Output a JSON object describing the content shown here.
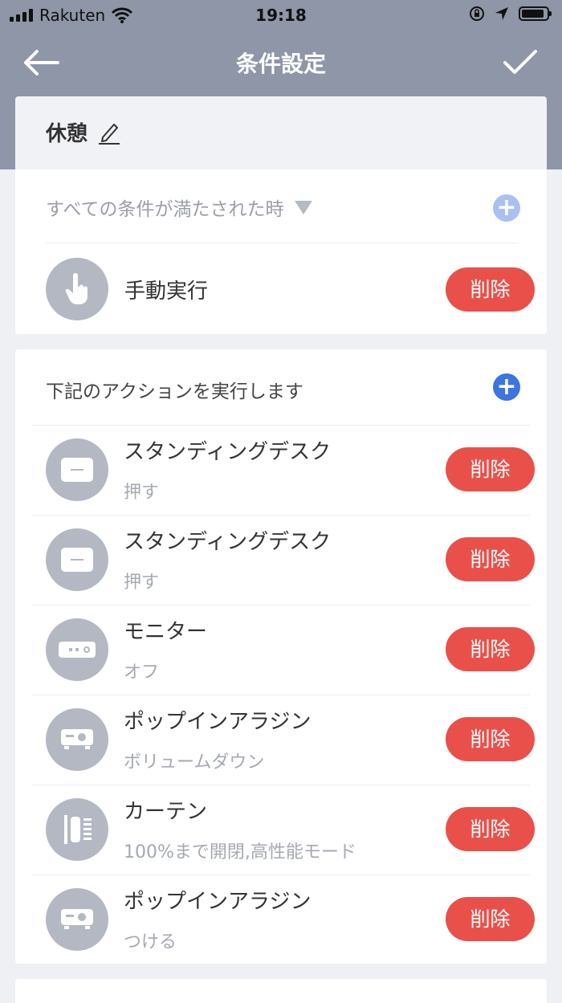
{
  "status_bar": {
    "carrier": "Rakuten",
    "time": "19:18"
  },
  "nav": {
    "title": "条件設定"
  },
  "scene": {
    "name": "休憩"
  },
  "conditions": {
    "header": "すべての条件が満たされた時",
    "items": [
      {
        "title": "手動実行",
        "icon": "hand-tap-icon",
        "delete_label": "削除"
      }
    ]
  },
  "actions": {
    "header": "下記のアクションを実行します",
    "items": [
      {
        "title": "スタンディングデスク",
        "sub": "押す",
        "icon": "bot-icon",
        "delete_label": "削除"
      },
      {
        "title": "スタンディングデスク",
        "sub": "押す",
        "icon": "bot-icon",
        "delete_label": "削除"
      },
      {
        "title": "モニター",
        "sub": "オフ",
        "icon": "remote-icon",
        "delete_label": "削除"
      },
      {
        "title": "ポップインアラジン",
        "sub": "ボリュームダウン",
        "icon": "projector-icon",
        "delete_label": "削除"
      },
      {
        "title": "カーテン",
        "sub": "100%まで開閉,高性能モード",
        "icon": "curtain-icon",
        "delete_label": "削除"
      },
      {
        "title": "ポップインアラジン",
        "sub": "つける",
        "icon": "projector-icon",
        "delete_label": "削除"
      }
    ]
  },
  "colors": {
    "header_bg": "#8e96a7",
    "delete": "#e9504a",
    "accent": "#3c74e0"
  }
}
